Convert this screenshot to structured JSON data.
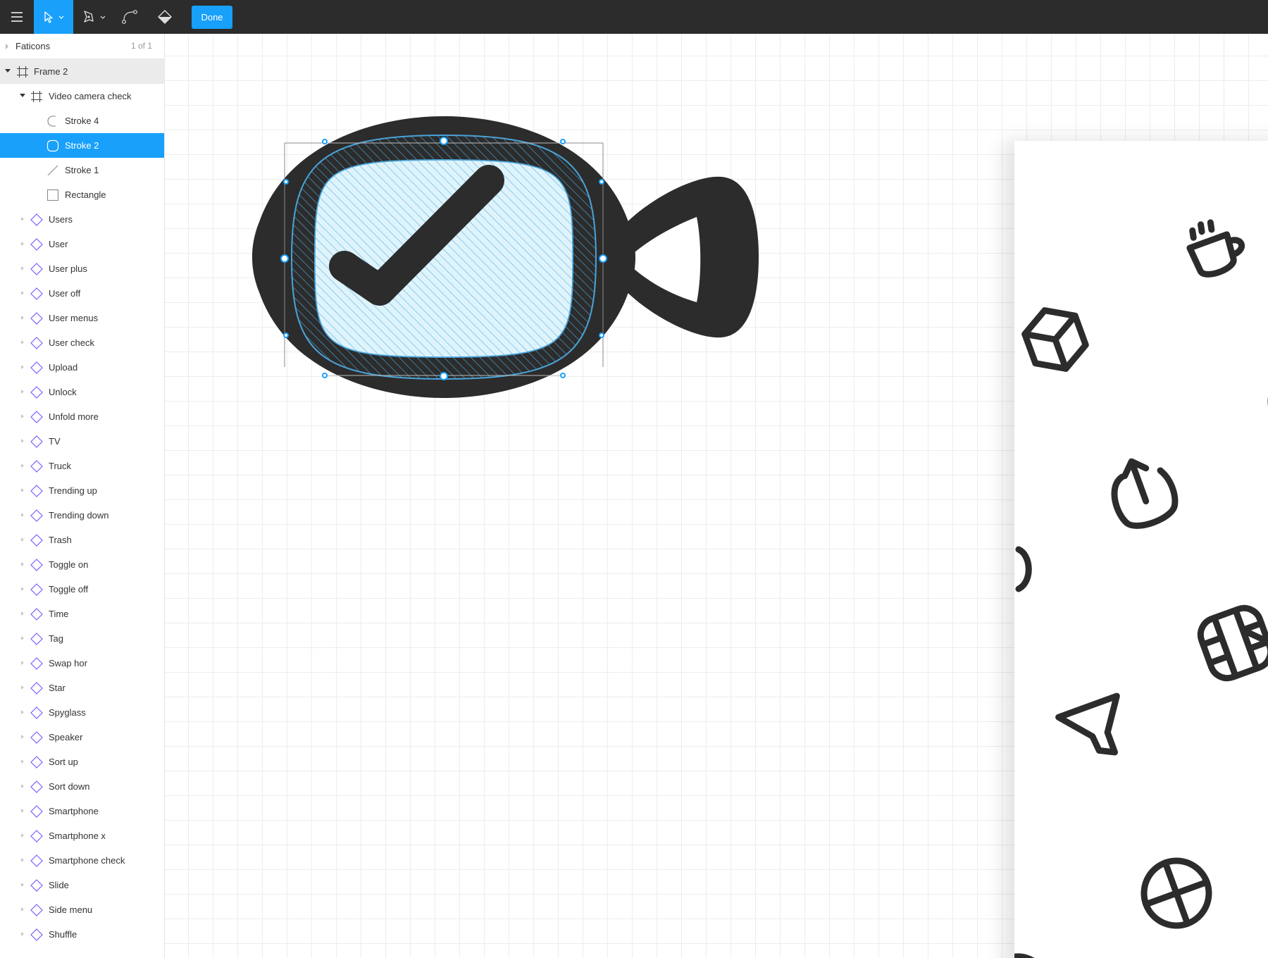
{
  "toolbar": {
    "done_label": "Done"
  },
  "layers": {
    "page": {
      "name": "Faticons",
      "count": "1 of 1"
    },
    "frame": {
      "name": "Frame 2"
    },
    "component": {
      "name": "Video camera check"
    },
    "children": [
      {
        "name": "Stroke 4",
        "icon": "vector-corner-icon",
        "selected": false
      },
      {
        "name": "Stroke 2",
        "icon": "vector-rounded-icon",
        "selected": true
      },
      {
        "name": "Stroke 1",
        "icon": "vector-line-icon",
        "selected": false
      },
      {
        "name": "Rectangle",
        "icon": "rectangle-icon",
        "selected": false
      }
    ],
    "items": [
      "Users",
      "User",
      "User plus",
      "User off",
      "User menus",
      "User check",
      "Upload",
      "Unlock",
      "Unfold more",
      "TV",
      "Truck",
      "Trending up",
      "Trending down",
      "Trash",
      "Toggle on",
      "Toggle off",
      "Time",
      "Tag",
      "Swap hor",
      "Star",
      "Spyglass",
      "Speaker",
      "Sort up",
      "Sort down",
      "Smartphone",
      "Smartphone x",
      "Smartphone check",
      "Slide",
      "Side menu",
      "Shuffle"
    ]
  },
  "colors": {
    "toolbar_bg": "#2c2c2c",
    "accent": "#18a0fb",
    "icon_fill": "#2c2c2c",
    "component_icon": "#7b61ff",
    "selection": "#4aa3d8"
  }
}
